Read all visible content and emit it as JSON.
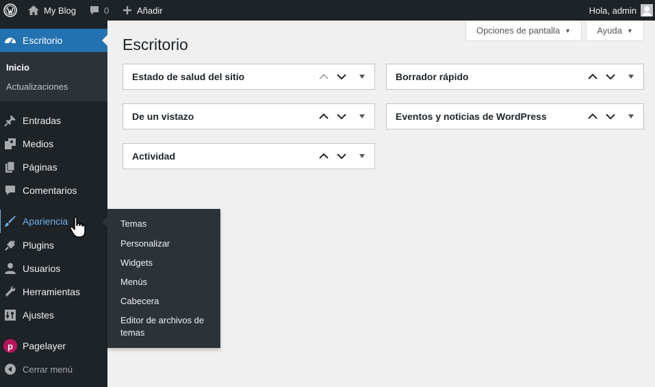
{
  "adminbar": {
    "site_name": "My Blog",
    "comments_count": "0",
    "new_label": "Añadir",
    "greeting": "Hola, admin"
  },
  "sidebar": {
    "dashboard": {
      "label": "Escritorio",
      "submenu": [
        "Inicio",
        "Actualizaciones"
      ]
    },
    "items": [
      {
        "label": "Entradas",
        "icon": "pushpin-icon"
      },
      {
        "label": "Medios",
        "icon": "media-icon"
      },
      {
        "label": "Páginas",
        "icon": "pages-icon"
      },
      {
        "label": "Comentarios",
        "icon": "comment-icon"
      },
      {
        "label": "Apariencia",
        "icon": "paintbrush-icon"
      },
      {
        "label": "Plugins",
        "icon": "plugin-icon"
      },
      {
        "label": "Usuarios",
        "icon": "user-icon"
      },
      {
        "label": "Herramientas",
        "icon": "wrench-icon"
      },
      {
        "label": "Ajustes",
        "icon": "settings-icon"
      },
      {
        "label": "Pagelayer",
        "icon": "pagelayer-icon"
      }
    ],
    "collapse_label": "Cerrar menú"
  },
  "appearance_flyout": [
    "Temas",
    "Personalizar",
    "Widgets",
    "Menús",
    "Cabecera",
    "Editor de archivos de temas"
  ],
  "screen_options_label": "Opciones de pantalla",
  "help_label": "Ayuda",
  "page_title": "Escritorio",
  "widgets": {
    "site_health": "Estado de salud del sitio",
    "at_a_glance": "De un vistazo",
    "activity": "Actividad",
    "quick_draft": "Borrador rápido",
    "events_news": "Eventos y noticias de WordPress"
  },
  "colors": {
    "adminbar_bg": "#1d2327",
    "menu_current": "#2271b1",
    "menu_hover": "#72aee6",
    "submenu_bg": "#2c3338",
    "content_bg": "#f0f0f1"
  }
}
